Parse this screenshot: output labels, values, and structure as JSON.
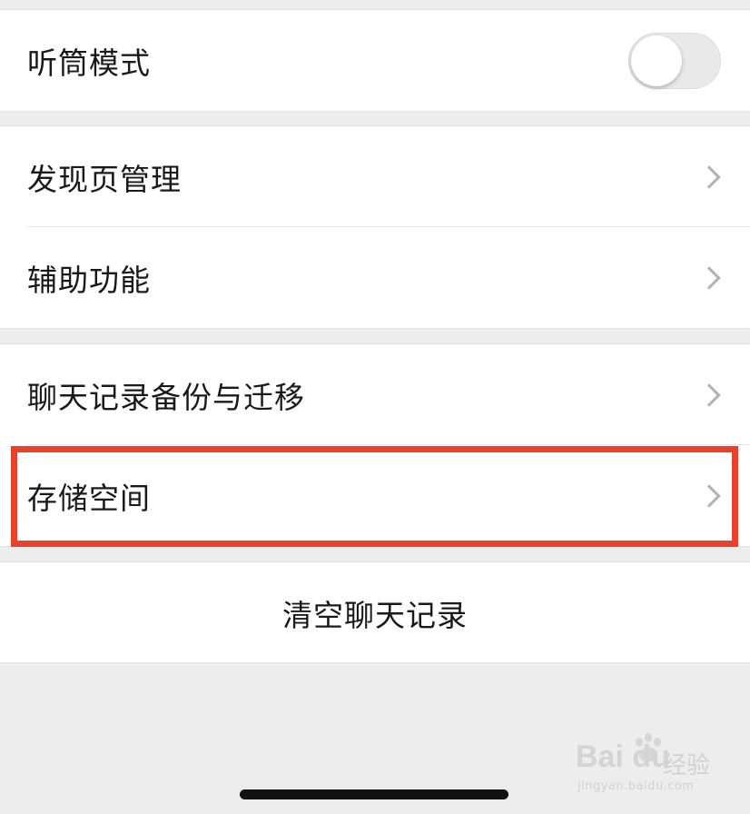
{
  "settings": {
    "earpiece_mode": {
      "label": "听筒模式",
      "enabled": false
    },
    "discover_manage": {
      "label": "发现页管理"
    },
    "accessibility": {
      "label": "辅助功能"
    },
    "chat_backup": {
      "label": "聊天记录备份与迁移"
    },
    "storage": {
      "label": "存储空间",
      "highlighted": true
    },
    "clear_history": {
      "label": "清空聊天记录"
    }
  },
  "watermark": {
    "brand": "Bai du",
    "suffix": "经验",
    "url": "jingyan.baidu.com"
  },
  "colors": {
    "background": "#ededed",
    "card": "#ffffff",
    "text": "#191919",
    "chevron": "#b2b2b2",
    "highlight_border": "#e8412c",
    "toggle_off": "#e9e9e9"
  }
}
